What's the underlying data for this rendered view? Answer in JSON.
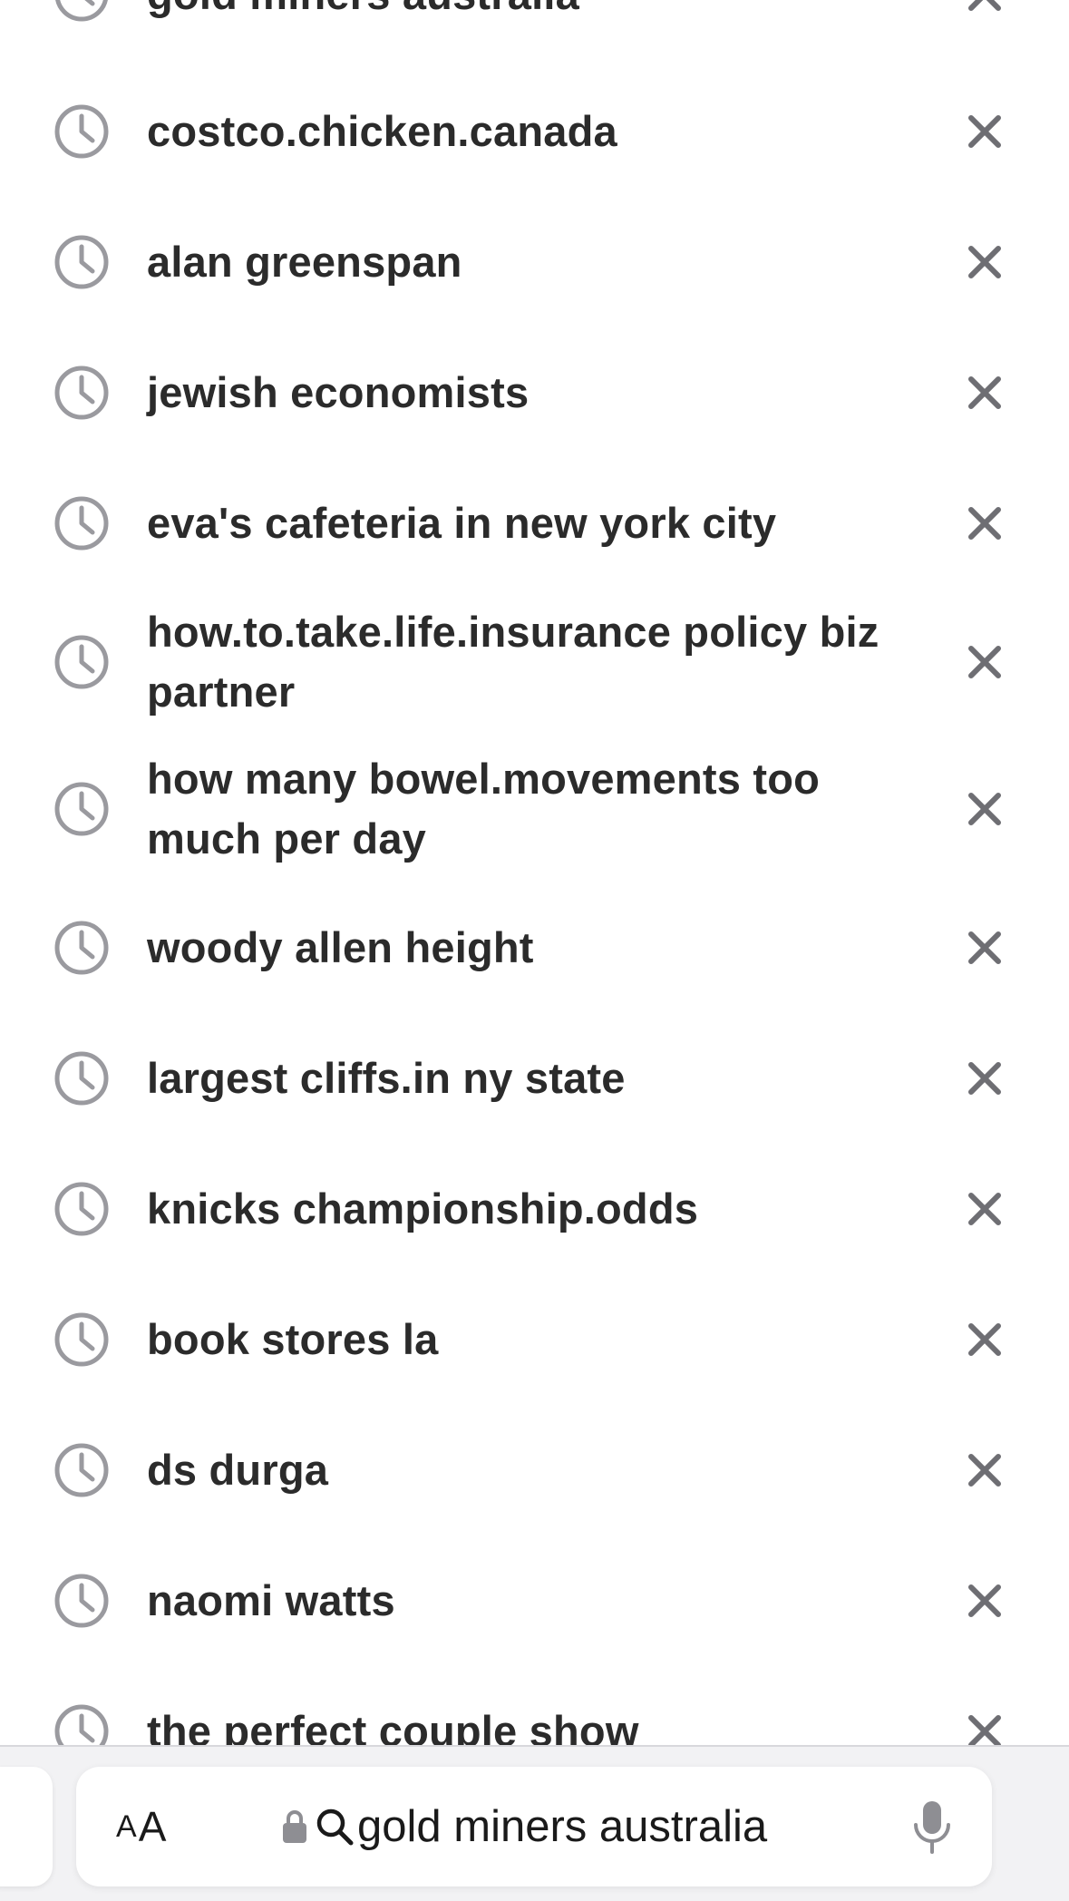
{
  "history": {
    "items": [
      {
        "label": "gold miners australia"
      },
      {
        "label": "costco.chicken.canada"
      },
      {
        "label": "alan greenspan"
      },
      {
        "label": "jewish economists"
      },
      {
        "label": "eva's cafeteria in new york city"
      },
      {
        "label": "how.to.take.life.insurance policy biz partner"
      },
      {
        "label": "how many bowel.movements too much per day"
      },
      {
        "label": "woody allen height"
      },
      {
        "label": "largest cliffs.in ny state"
      },
      {
        "label": "knicks championship.odds"
      },
      {
        "label": "book stores la"
      },
      {
        "label": "ds durga"
      },
      {
        "label": "naomi watts"
      },
      {
        "label": "the perfect couple show"
      }
    ],
    "item_icon": "clock-icon",
    "remove_icon": "close-icon"
  },
  "toolbar": {
    "reader_button": {
      "small": "A",
      "big": "A"
    },
    "address": {
      "text": "gold miners australia",
      "lock_icon": "lock-icon",
      "search_icon": "search-icon"
    },
    "mic_icon": "microphone-icon"
  },
  "colors": {
    "text": "#2b2b2b",
    "icon_gray": "#9a9a9f",
    "remove_gray": "#6e6e73",
    "toolbar_bg": "#f2f2f4"
  }
}
